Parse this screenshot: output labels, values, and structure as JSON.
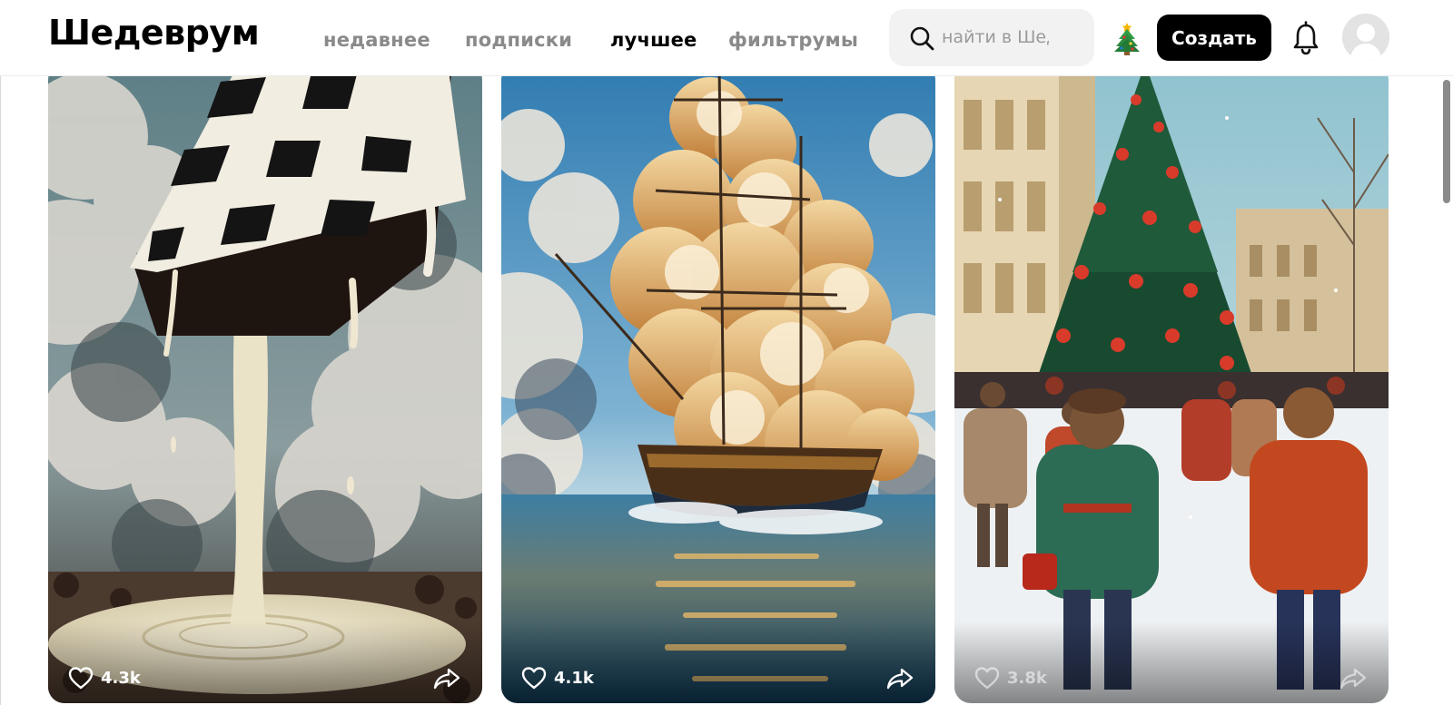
{
  "header": {
    "logo": "Шедеврум",
    "tabs": [
      {
        "label": "недавнее",
        "active": false
      },
      {
        "label": "подписки",
        "active": false
      },
      {
        "label": "лучшее",
        "active": true
      },
      {
        "label": "фильтрумы",
        "active": false
      }
    ],
    "search": {
      "placeholder": "найти в Шедевруме",
      "value": "",
      "icon": "search-icon"
    },
    "holiday_icon": "christmas-tree-icon",
    "create_label": "Создать",
    "notifications_icon": "bell-icon",
    "avatar_icon": "user-avatar-icon"
  },
  "feed": {
    "cards": [
      {
        "subject": "melting-checkerboard-cake",
        "likes": "4.3k"
      },
      {
        "subject": "sailing-ship-of-clouds",
        "likes": "4.1k"
      },
      {
        "subject": "christmas-tree-square",
        "likes": "3.8k"
      }
    ]
  },
  "colors": {
    "brand_black": "#000000",
    "muted_tab": "#8a8a8a",
    "search_bg": "#f2f2f2"
  }
}
